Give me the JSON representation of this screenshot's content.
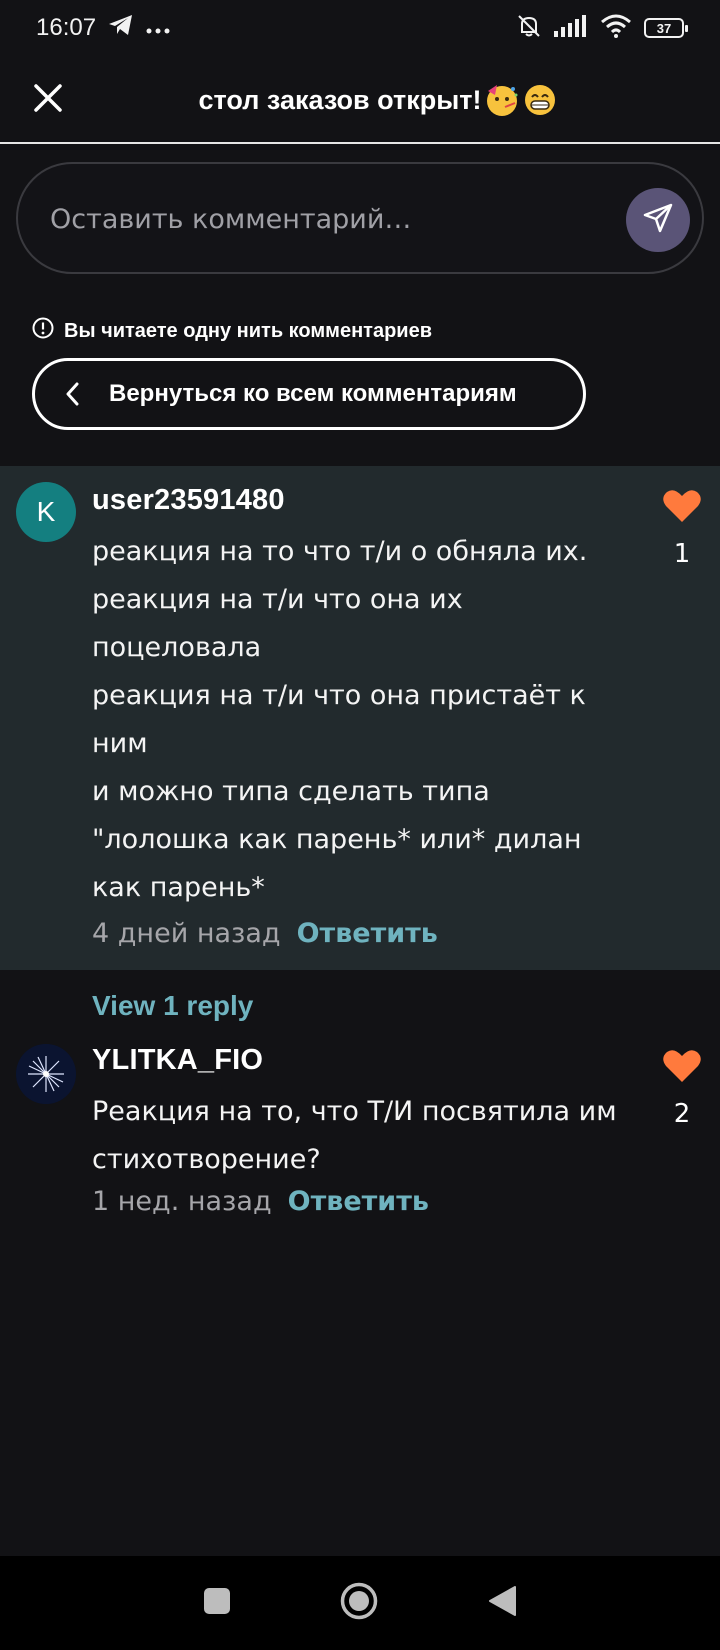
{
  "status_bar": {
    "time": "16:07",
    "app_icons": [
      "telegram-icon",
      "more-dots-icon"
    ],
    "system_icons": [
      "mute-bell-icon",
      "signal-icon",
      "wifi-icon",
      "battery-icon"
    ],
    "battery_level": "37"
  },
  "header": {
    "title": "стол заказов открыт!",
    "close_icon": "close-icon"
  },
  "comment_input": {
    "placeholder": "Оставить комментарий…",
    "send_icon": "send-icon"
  },
  "thread_notice": {
    "text": "Вы читаете одну нить комментариев",
    "icon": "info-icon"
  },
  "back_button": {
    "label": "Вернуться ко всем комментариям",
    "icon": "chevron-left-icon"
  },
  "comments": [
    {
      "avatar_letter": "K",
      "username": "user23591480",
      "lines": [
        "реакция на то что т/и о обняла их.",
        "реакция на т/и что она их",
        "поцеловала",
        "реакция на т/и что она пристаёт к",
        "ним",
        "и можно типа сделать типа",
        "\"лолошка как парень* или* дилан",
        "как парень*"
      ],
      "time": "4 дней назад",
      "reply_label": "Ответить",
      "likes": "1"
    },
    {
      "avatar_letter": "",
      "username": "YLITKA_FIO",
      "lines": [
        "Реакция на то, что Т/И посвятила им",
        "стихотворение?"
      ],
      "time": "1 нед. назад",
      "reply_label": "Ответить",
      "likes": "2"
    }
  ],
  "view_replies_label": "View 1 reply",
  "colors": {
    "background": "#121215",
    "highlight": "#222a2d",
    "accent": "#6fb3bf",
    "heart": "#ff7a3d",
    "send_button": "#5a5477",
    "avatar_teal": "#147f80"
  },
  "nav_bar": {
    "buttons": [
      "recents-square-icon",
      "home-circle-icon",
      "back-triangle-icon"
    ]
  }
}
